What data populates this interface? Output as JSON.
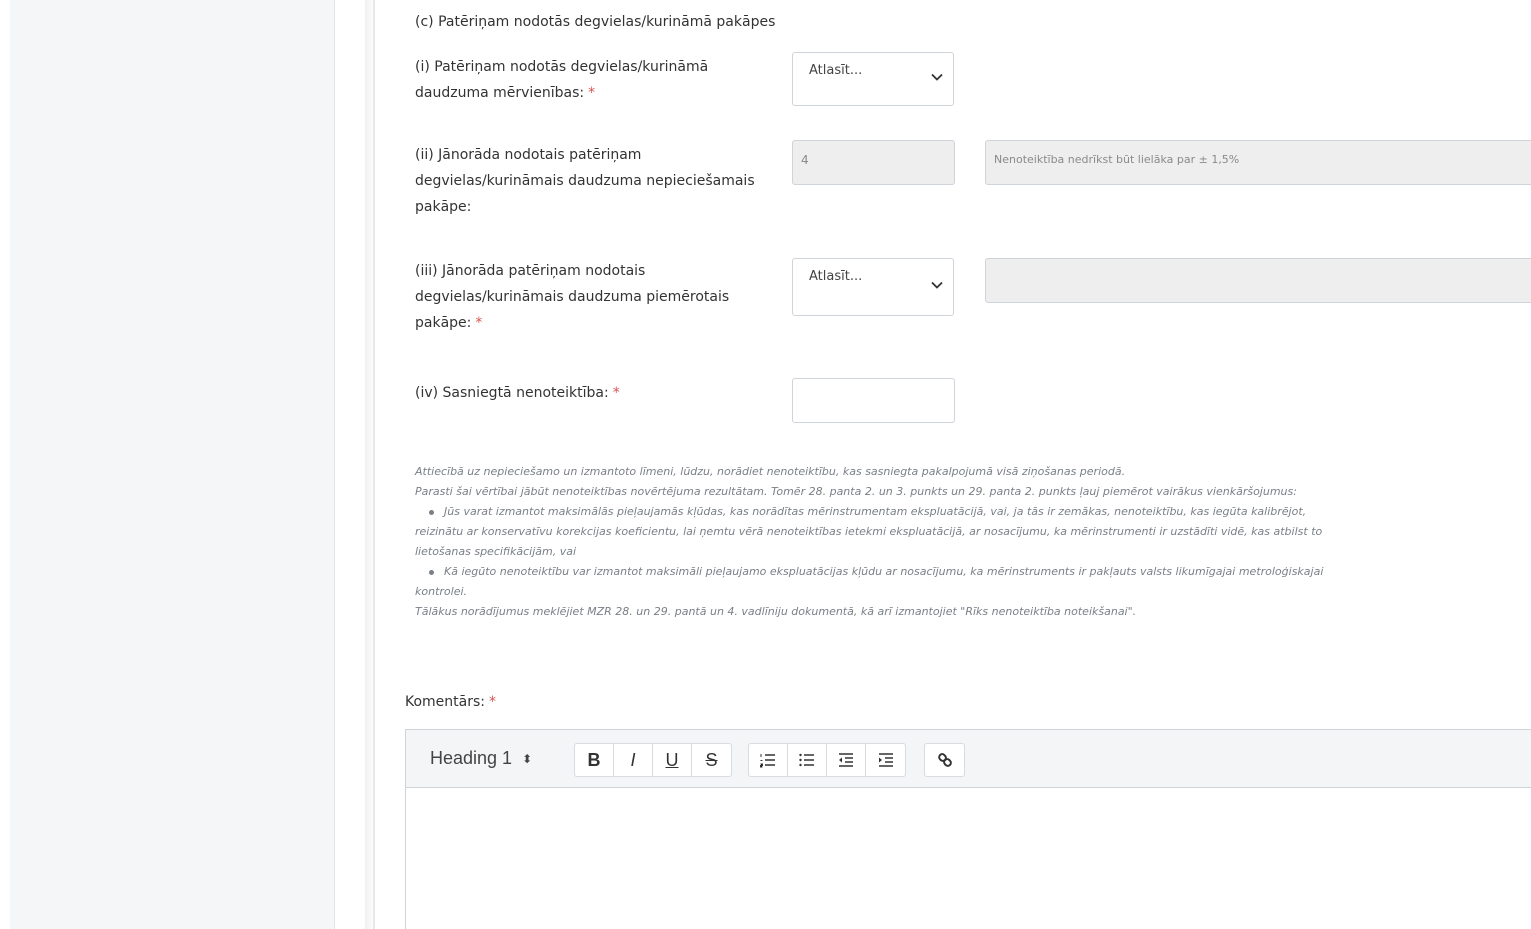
{
  "section": {
    "title": "(c) Patēriņam nodotās degvielas/kurināmā pakāpes"
  },
  "fields": {
    "units": {
      "label": "(i) Patēriņam nodotās degvielas/kurināmā daudzuma mērvienības:",
      "required": "*",
      "select_value": "Atlasīt..."
    },
    "required_tier": {
      "label": "(ii) Jānorāda nodotais patēriņam degvielas/kurināmais daudzuma nepieciešamais pakāpe:",
      "value": "4",
      "note": "Nenoteiktība nedrīkst būt lielāka par ± 1,5%"
    },
    "applied_tier": {
      "label": "(iii) Jānorāda patēriņam nodotais degvielas/kurināmais daudzuma piemērotais pakāpe:",
      "required": "*",
      "select_value": "Atlasīt...",
      "side_value": ""
    },
    "uncertainty": {
      "label": "(iv) Sasniegtā nenoteiktība:",
      "required": "*",
      "value": ""
    }
  },
  "help": {
    "line1": "Attiecībā uz nepieciešamo un izmantoto līmeni, lūdzu, norādiet nenoteiktību, kas sasniegta pakalpojumā visā ziņošanas periodā.",
    "line2": "Parasti šai vērtībai jābūt nenoteiktības novērtējuma rezultātam. Tomēr 28. panta 2. un 3. punkts un 29. panta 2. punkts ļauj piemērot vairākus vienkāršojumus:",
    "bullet1_a": "Jūs varat izmantot maksimālās pieļaujamās kļūdas, kas norādītas mērinstrumentam ekspluatācijā, vai, ja tās ir zemākas, nenoteiktību, kas iegūta kalibrējot,",
    "bullet1_b": "reizinātu ar konservatīvu korekcijas koeficientu, lai ņemtu vērā nenoteiktības ietekmi ekspluatācijā, ar nosacījumu, ka mērinstrumenti ir uzstādīti vidē, kas atbilst to",
    "bullet1_c": "lietošanas specifikācijām, vai",
    "bullet2_a": "Kā iegūto nenoteiktību var izmantot maksimāli pieļaujamo ekspluatācijas kļūdu ar nosacījumu, ka mērinstruments ir pakļauts valsts likumīgajai metroloģiskajai",
    "bullet2_b": "kontrolei.",
    "line3": "Tālākus norādījumus meklējiet MZR 28. un 29. pantā un 4. vadlīniju dokumentā, kā arī izmantojiet \"Rīks nenoteiktība noteikšanai\"."
  },
  "comment": {
    "label": "Komentārs:",
    "required": "*"
  },
  "toolbar": {
    "heading": "Heading 1",
    "caret": "⬍",
    "bold": "B",
    "italic": "I",
    "underline": "U",
    "strike": "S"
  },
  "colors": {
    "required": "#d9534f",
    "sidebar": "#f5f6f8",
    "disabled_input": "#eeeeee"
  }
}
